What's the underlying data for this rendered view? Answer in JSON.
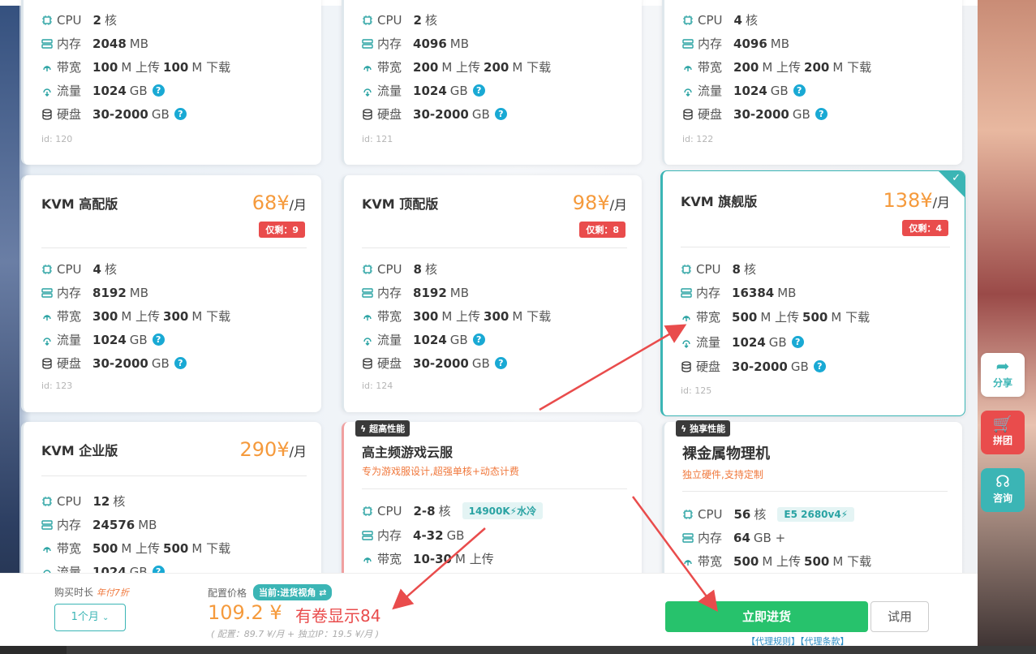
{
  "labels": {
    "cpu": "CPU",
    "mem": "内存",
    "bw": "带宽",
    "traffic": "流量",
    "disk": "硬盘",
    "core": "核",
    "mb": "MB",
    "gb": "GB",
    "up": "M 上传",
    "down": "M 下载",
    "q": "?",
    "per_month": "/月",
    "yen": "¥"
  },
  "cards_top": [
    {
      "cpu": "2",
      "mem": "2048",
      "up": "100",
      "down": "100",
      "traffic": "1024",
      "disk": "30-2000",
      "id": "id: 120"
    },
    {
      "cpu": "2",
      "mem": "4096",
      "up": "200",
      "down": "200",
      "traffic": "1024",
      "disk": "30-2000",
      "id": "id: 121"
    },
    {
      "cpu": "4",
      "mem": "4096",
      "up": "200",
      "down": "200",
      "traffic": "1024",
      "disk": "30-2000",
      "id": "id: 122"
    }
  ],
  "cards_mid": [
    {
      "title": "KVM 高配版",
      "price": "68",
      "stock": "仅剩：9",
      "cpu": "4",
      "mem": "8192",
      "up": "300",
      "down": "300",
      "traffic": "1024",
      "disk": "30-2000",
      "id": "id: 123"
    },
    {
      "title": "KVM 顶配版",
      "price": "98",
      "stock": "仅剩：8",
      "cpu": "8",
      "mem": "8192",
      "up": "300",
      "down": "300",
      "traffic": "1024",
      "disk": "30-2000",
      "id": "id: 124"
    },
    {
      "title": "KVM 旗舰版",
      "price": "138",
      "stock": "仅剩：4",
      "cpu": "8",
      "mem": "16384",
      "up": "500",
      "down": "500",
      "traffic": "1024",
      "disk": "30-2000",
      "id": "id: 125",
      "selected": true
    }
  ],
  "card_enterprise": {
    "title": "KVM 企业版",
    "price": "290",
    "cpu": "12",
    "mem": "24576",
    "up": "500",
    "down": "500",
    "traffic": "1024"
  },
  "card_game": {
    "tag": "超高性能",
    "title": "高主频游戏云服",
    "subtitle": "专为游戏服设计,超强单核+动态计费",
    "cpu": "2-8",
    "chip": "14900K⚡水冷",
    "mem": "4-32",
    "bw": "10-30",
    "bw_suffix": "M 上传"
  },
  "card_metal": {
    "tag": "独享性能",
    "title": "裸金属物理机",
    "subtitle": "独立硬件,支持定制",
    "cpu": "56",
    "chip": "E5 2680v4⚡",
    "mem": "64",
    "mem_suffix": "GB +",
    "up": "500",
    "down": "500"
  },
  "side": {
    "share": "分享",
    "group": "拼团",
    "consult": "咨询"
  },
  "footer": {
    "duration_label": "购买时长",
    "discount": "年付7折",
    "duration_value": "1个月",
    "price_label": "配置价格",
    "view_badge": "当前:进货视角 ⇄",
    "price": "109.2 ¥",
    "coupon_note": "有卷显示84",
    "breakdown": "( 配置：89.7 ¥/月 + 独立IP：19.5 ¥/月 )",
    "buy_button": "立即进货",
    "trial_button": "试用",
    "links": "【代理规则】【代理条款】"
  },
  "colors": {
    "accent": "#3bb5b5",
    "price": "#f59a3c",
    "stock": "#e94c4c",
    "buy": "#27c26c",
    "arrow": "#e94c4c"
  }
}
